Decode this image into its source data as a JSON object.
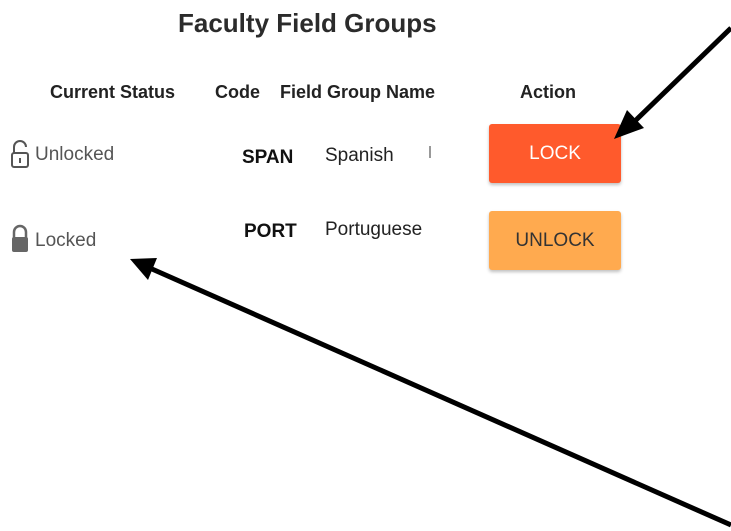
{
  "title": "Faculty Field Groups",
  "table": {
    "headers": {
      "status": "Current Status",
      "code": "Code",
      "name": "Field Group Name",
      "action": "Action"
    },
    "rows": [
      {
        "status": "Unlocked",
        "status_icon": "unlocked-padlock-icon",
        "code": "SPAN",
        "name": "Spanish",
        "action": "LOCK"
      },
      {
        "status": "Locked",
        "status_icon": "locked-padlock-icon",
        "code": "PORT",
        "name": "Portuguese",
        "action": "UNLOCK"
      }
    ]
  },
  "colors": {
    "lock_button": "#ff5a2c",
    "unlock_button": "#ffaa4f",
    "annotation_arrow": "#000000"
  }
}
